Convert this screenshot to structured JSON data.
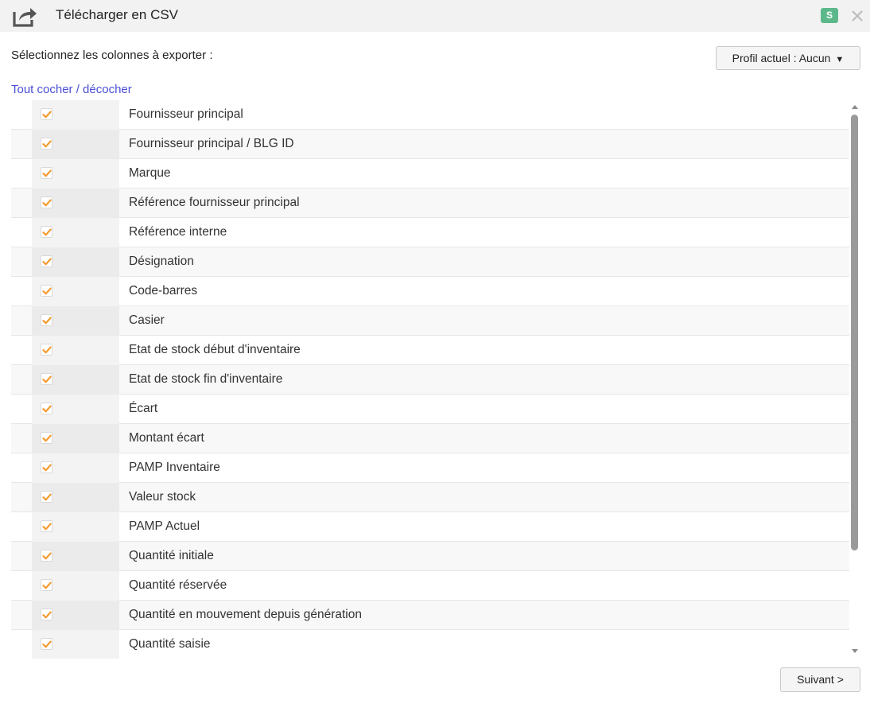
{
  "header": {
    "title": "Télécharger en CSV",
    "icon": "share-export-icon",
    "badge": "S",
    "badge_color": "#5cb88a",
    "close_glyph": "✕"
  },
  "instruction": "Sélectionnez les colonnes à exporter :",
  "profile_button": {
    "label": "Profil actuel : Aucun",
    "caret": "▼"
  },
  "toggle_all_label": "Tout cocher / décocher",
  "accent_color": "#f39b32",
  "link_color": "#4a4fd6",
  "columns": [
    {
      "label": "Fournisseur principal",
      "checked": true
    },
    {
      "label": "Fournisseur principal / BLG ID",
      "checked": true
    },
    {
      "label": "Marque",
      "checked": true
    },
    {
      "label": "Référence fournisseur principal",
      "checked": true
    },
    {
      "label": "Référence interne",
      "checked": true
    },
    {
      "label": "Désignation",
      "checked": true
    },
    {
      "label": "Code-barres",
      "checked": true
    },
    {
      "label": "Casier",
      "checked": true
    },
    {
      "label": "Etat de stock début d'inventaire",
      "checked": true
    },
    {
      "label": "Etat de stock fin d'inventaire",
      "checked": true
    },
    {
      "label": "Écart",
      "checked": true
    },
    {
      "label": "Montant écart",
      "checked": true
    },
    {
      "label": "PAMP Inventaire",
      "checked": true
    },
    {
      "label": "Valeur stock",
      "checked": true
    },
    {
      "label": "PAMP Actuel",
      "checked": true
    },
    {
      "label": "Quantité initiale",
      "checked": true
    },
    {
      "label": "Quantité réservée",
      "checked": true
    },
    {
      "label": "Quantité en mouvement depuis génération",
      "checked": true
    },
    {
      "label": "Quantité saisie",
      "checked": true
    }
  ],
  "next_button_label": "Suivant >"
}
